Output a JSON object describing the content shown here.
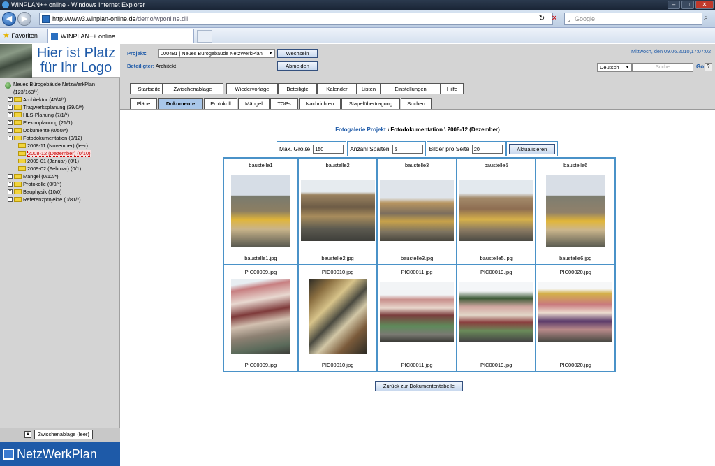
{
  "window": {
    "title": "WINPLAN++ online - Windows Internet Explorer",
    "url_host": "http://www3.winplan-online.de",
    "url_path": "/demo/wponline.dll",
    "search_placeholder": "Google",
    "favorites_label": "Favoriten",
    "tab_title": "WINPLAN++ online"
  },
  "logo": {
    "line1": "Hier ist Platz",
    "line2": "für Ihr Logo"
  },
  "tree": {
    "root_line1": "Neues Bürogebäude NetzWerkPlan",
    "root_line2": "(123/163/*)",
    "nodes": [
      "Architektur (46/4/*)",
      "Tragwerksplanung (39/0/*)",
      "HLS-Planung (7/1/*)",
      "Elektroplanung (21/1)",
      "Dokumente (0/50/*)",
      "Fotodokumentation (0/12)"
    ],
    "children": [
      "2008-11 (November) (leer)",
      "2008-12 (Dezember) (0/10)",
      "2009-01 (Januar) (0/1)",
      "2009-02 (Februar) (0/1)"
    ],
    "nodes_after": [
      "Mängel (0/12/*)",
      "Protokolle (0/0/*)",
      "Bauphysik (10/0)",
      "Referenzprojekte (0/81/*)"
    ]
  },
  "clipboard": {
    "label": "Zwischenablage (leer)"
  },
  "brand": {
    "name": "NetzWerkPlan"
  },
  "header": {
    "projekt_label": "Projekt:",
    "projekt_value": "000481 | Neues Bürogebäude NetzWerkPlan",
    "wechseln": "Wechseln",
    "beteiligter_label": "Beteiligter:",
    "beteiligter_value": "Architekt",
    "abmelden": "Abmelden",
    "datetime": "Mittwoch, den 09.06.2010,17:07:02",
    "language": "Deutsch",
    "search_placeholder": "Suche",
    "go": "Go"
  },
  "tabs_main": [
    "Startseite",
    "Zwischenablage",
    "Wiedervorlage",
    "Beteiligte",
    "Kalender",
    "Listen",
    "Einstellungen",
    "Hilfe"
  ],
  "tabs_sub": [
    "Pläne",
    "Dokumente",
    "Protokoll",
    "Mängel",
    "TOPs",
    "Nachrichten",
    "Stapelübertragung",
    "Suchen"
  ],
  "gallery": {
    "crumb_link": "Fotogalerie Projekt",
    "crumb_rest": " \\ Fotodokumentation \\ 2008-12 (Dezember)",
    "max_size_label": "Max. Größe",
    "max_size_value": "150",
    "columns_label": "Anzahl Spalten",
    "columns_value": "5",
    "per_page_label": "Bilder pro Seite",
    "per_page_value": "20",
    "refresh": "Aktualisieren",
    "back": "Zurück zur Dokumententabelle",
    "items": [
      {
        "title": "baustelle1",
        "file": "baustelle1.jpg"
      },
      {
        "title": "baustelle2",
        "file": "baustelle2.jpg"
      },
      {
        "title": "baustelle3",
        "file": "baustelle3.jpg"
      },
      {
        "title": "baustelle5",
        "file": "baustelle5.jpg"
      },
      {
        "title": "baustelle6",
        "file": "baustelle6.jpg"
      },
      {
        "title": "PIC00009.jpg",
        "file": "PIC00009.jpg"
      },
      {
        "title": "PIC00010.jpg",
        "file": "PIC00010.jpg"
      },
      {
        "title": "PIC00011.jpg",
        "file": "PIC00011.jpg"
      },
      {
        "title": "PIC00019.jpg",
        "file": "PIC00019.jpg"
      },
      {
        "title": "PIC00020.jpg",
        "file": "PIC00020.jpg"
      }
    ]
  },
  "colors": {
    "accent": "#1e5aa8",
    "active_tab": "#a9c7ea",
    "gallery_border": "#4a92c8",
    "selected_tree": "#cc0000"
  }
}
